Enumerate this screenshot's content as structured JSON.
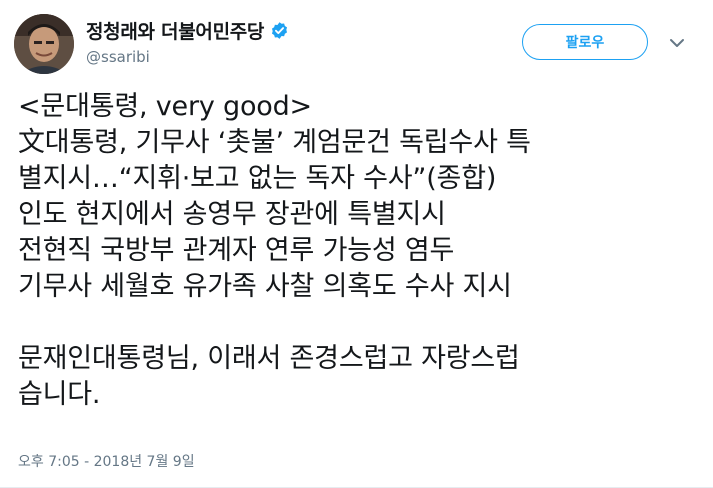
{
  "user": {
    "display_name": "정청래와 더불어민주당",
    "handle": "@ssaribi",
    "verified": true
  },
  "actions": {
    "follow_label": "팔로우"
  },
  "tweet": {
    "lines": [
      "<문대통령, very good>",
      "文대통령, 기무사 ‘촛불’ 계엄문건 독립수사 특",
      "별지시…“지휘·보고 없는 독자 수사”(종합)",
      "인도 현지에서 송영무 장관에 특별지시",
      "전현직 국방부 관계자 연루 가능성 염두",
      "기무사 세월호 유가족 사찰 의혹도 수사 지시",
      "",
      "문재인대통령님, 이래서 존경스럽고 자랑스럽",
      "습니다."
    ],
    "timestamp": "오후 7:05 - 2018년 7월 9일"
  },
  "colors": {
    "accent": "#1da1f2",
    "text": "#14171a",
    "secondary": "#657786"
  },
  "icons": {
    "verified": "verified-badge-icon",
    "caret": "chevron-down-icon"
  }
}
